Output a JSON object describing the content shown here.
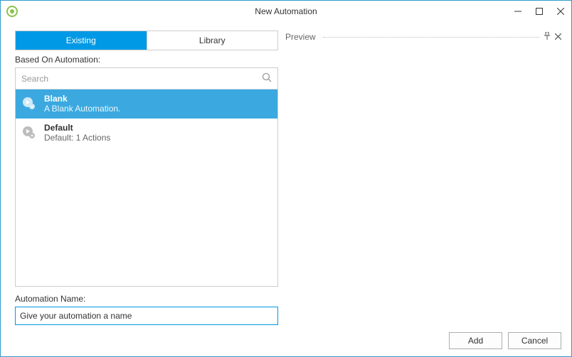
{
  "window": {
    "title": "New Automation"
  },
  "tabs": {
    "existing": "Existing",
    "library": "Library"
  },
  "labels": {
    "basedOn": "Based On Automation:",
    "automationName": "Automation Name:"
  },
  "search": {
    "placeholder": "Search"
  },
  "items": [
    {
      "title": "Blank",
      "desc": "A Blank Automation."
    },
    {
      "title": "Default",
      "desc": "Default: 1 Actions"
    }
  ],
  "nameInput": {
    "value": "Give your automation a name"
  },
  "preview": {
    "title": "Preview"
  },
  "buttons": {
    "add": "Add",
    "cancel": "Cancel"
  }
}
